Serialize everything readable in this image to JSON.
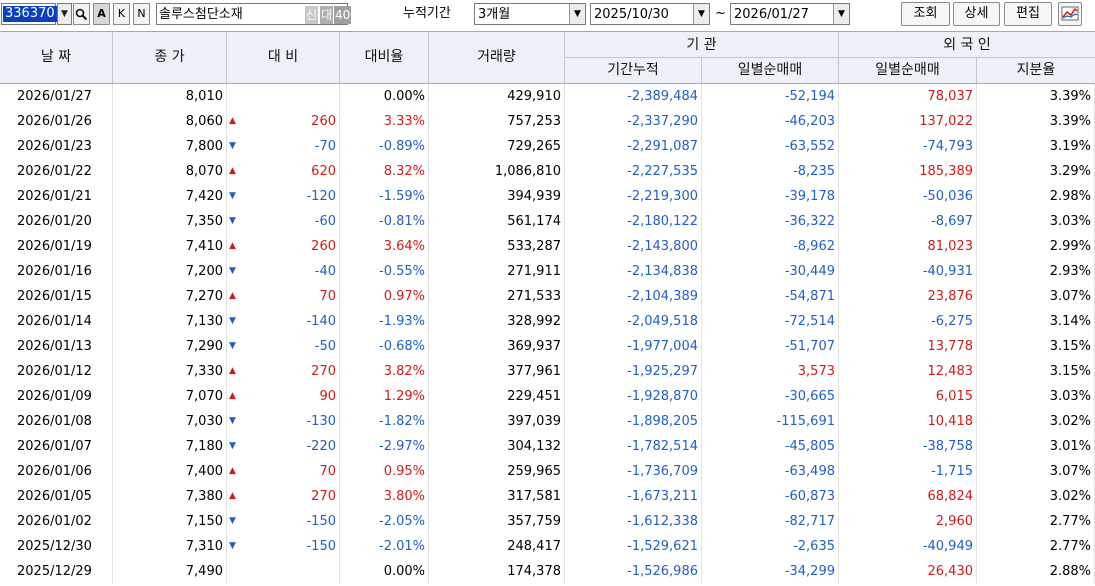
{
  "toolbar": {
    "code": "336370",
    "code_dropdown_icon": "chevron-down-icon",
    "search_icon": "search-icon",
    "button_a": "A",
    "button_k": "K",
    "button_n": "N",
    "stock_name": "솔루스첨단소재",
    "badge_sin": "신",
    "badge_dae": "대",
    "badge_40": "40",
    "period_label": "누적기간",
    "period_value": "3개월",
    "date_from": "2025/10/30",
    "tilde": "~",
    "date_to": "2026/01/27",
    "query_button": "조회",
    "detail_button": "상세",
    "edit_button": "편집",
    "chart_icon": "line-chart-icon"
  },
  "colors": {
    "up": "#d11a1a",
    "down": "#1f5fc7",
    "header_bg": "#eef0f8",
    "selection": "#0a3fbf"
  },
  "headers": {
    "date": "날 짜",
    "close": "종 가",
    "change": "대 비",
    "pct": "대비율",
    "volume": "거래량",
    "institution": "기 관",
    "inst_cum": "기간누적",
    "inst_daily": "일별순매매",
    "foreign": "외 국 인",
    "foreign_daily": "일별순매매",
    "share": "지분율"
  },
  "rows": [
    {
      "date": "2026/01/27",
      "close": "8,010",
      "dir": "none",
      "change": "",
      "pct": "0.00%",
      "volume": "429,910",
      "inst_cum": "-2,389,484",
      "inst_daily": "-52,194",
      "foreign_daily": "78,037",
      "share": "3.39%"
    },
    {
      "date": "2026/01/26",
      "close": "8,060",
      "dir": "up",
      "change": "260",
      "pct": "3.33%",
      "volume": "757,253",
      "inst_cum": "-2,337,290",
      "inst_daily": "-46,203",
      "foreign_daily": "137,022",
      "share": "3.39%"
    },
    {
      "date": "2026/01/23",
      "close": "7,800",
      "dir": "down",
      "change": "-70",
      "pct": "-0.89%",
      "volume": "729,265",
      "inst_cum": "-2,291,087",
      "inst_daily": "-63,552",
      "foreign_daily": "-74,793",
      "share": "3.19%"
    },
    {
      "date": "2026/01/22",
      "close": "8,070",
      "dir": "up",
      "change": "620",
      "pct": "8.32%",
      "volume": "1,086,810",
      "inst_cum": "-2,227,535",
      "inst_daily": "-8,235",
      "foreign_daily": "185,389",
      "share": "3.29%"
    },
    {
      "date": "2026/01/21",
      "close": "7,420",
      "dir": "down",
      "change": "-120",
      "pct": "-1.59%",
      "volume": "394,939",
      "inst_cum": "-2,219,300",
      "inst_daily": "-39,178",
      "foreign_daily": "-50,036",
      "share": "2.98%"
    },
    {
      "date": "2026/01/20",
      "close": "7,350",
      "dir": "down",
      "change": "-60",
      "pct": "-0.81%",
      "volume": "561,174",
      "inst_cum": "-2,180,122",
      "inst_daily": "-36,322",
      "foreign_daily": "-8,697",
      "share": "3.03%"
    },
    {
      "date": "2026/01/19",
      "close": "7,410",
      "dir": "up",
      "change": "260",
      "pct": "3.64%",
      "volume": "533,287",
      "inst_cum": "-2,143,800",
      "inst_daily": "-8,962",
      "foreign_daily": "81,023",
      "share": "2.99%"
    },
    {
      "date": "2026/01/16",
      "close": "7,200",
      "dir": "down",
      "change": "-40",
      "pct": "-0.55%",
      "volume": "271,911",
      "inst_cum": "-2,134,838",
      "inst_daily": "-30,449",
      "foreign_daily": "-40,931",
      "share": "2.93%"
    },
    {
      "date": "2026/01/15",
      "close": "7,270",
      "dir": "up",
      "change": "70",
      "pct": "0.97%",
      "volume": "271,533",
      "inst_cum": "-2,104,389",
      "inst_daily": "-54,871",
      "foreign_daily": "23,876",
      "share": "3.07%"
    },
    {
      "date": "2026/01/14",
      "close": "7,130",
      "dir": "down",
      "change": "-140",
      "pct": "-1.93%",
      "volume": "328,992",
      "inst_cum": "-2,049,518",
      "inst_daily": "-72,514",
      "foreign_daily": "-6,275",
      "share": "3.14%"
    },
    {
      "date": "2026/01/13",
      "close": "7,290",
      "dir": "down",
      "change": "-50",
      "pct": "-0.68%",
      "volume": "369,937",
      "inst_cum": "-1,977,004",
      "inst_daily": "-51,707",
      "foreign_daily": "13,778",
      "share": "3.15%"
    },
    {
      "date": "2026/01/12",
      "close": "7,330",
      "dir": "up",
      "change": "270",
      "pct": "3.82%",
      "volume": "377,961",
      "inst_cum": "-1,925,297",
      "inst_daily": "3,573",
      "foreign_daily": "12,483",
      "share": "3.15%"
    },
    {
      "date": "2026/01/09",
      "close": "7,070",
      "dir": "up",
      "change": "90",
      "pct": "1.29%",
      "volume": "229,451",
      "inst_cum": "-1,928,870",
      "inst_daily": "-30,665",
      "foreign_daily": "6,015",
      "share": "3.03%"
    },
    {
      "date": "2026/01/08",
      "close": "7,030",
      "dir": "down",
      "change": "-130",
      "pct": "-1.82%",
      "volume": "397,039",
      "inst_cum": "-1,898,205",
      "inst_daily": "-115,691",
      "foreign_daily": "10,418",
      "share": "3.02%"
    },
    {
      "date": "2026/01/07",
      "close": "7,180",
      "dir": "down",
      "change": "-220",
      "pct": "-2.97%",
      "volume": "304,132",
      "inst_cum": "-1,782,514",
      "inst_daily": "-45,805",
      "foreign_daily": "-38,758",
      "share": "3.01%"
    },
    {
      "date": "2026/01/06",
      "close": "7,400",
      "dir": "up",
      "change": "70",
      "pct": "0.95%",
      "volume": "259,965",
      "inst_cum": "-1,736,709",
      "inst_daily": "-63,498",
      "foreign_daily": "-1,715",
      "share": "3.07%"
    },
    {
      "date": "2026/01/05",
      "close": "7,380",
      "dir": "up",
      "change": "270",
      "pct": "3.80%",
      "volume": "317,581",
      "inst_cum": "-1,673,211",
      "inst_daily": "-60,873",
      "foreign_daily": "68,824",
      "share": "3.02%"
    },
    {
      "date": "2026/01/02",
      "close": "7,150",
      "dir": "down",
      "change": "-150",
      "pct": "-2.05%",
      "volume": "357,759",
      "inst_cum": "-1,612,338",
      "inst_daily": "-82,717",
      "foreign_daily": "2,960",
      "share": "2.77%"
    },
    {
      "date": "2025/12/30",
      "close": "7,310",
      "dir": "down",
      "change": "-150",
      "pct": "-2.01%",
      "volume": "248,417",
      "inst_cum": "-1,529,621",
      "inst_daily": "-2,635",
      "foreign_daily": "-40,949",
      "share": "2.77%"
    },
    {
      "date": "2025/12/29",
      "close": "7,490",
      "dir": "none",
      "change": "",
      "pct": "0.00%",
      "volume": "174,378",
      "inst_cum": "-1,526,986",
      "inst_daily": "-34,299",
      "foreign_daily": "26,430",
      "share": "2.88%"
    }
  ]
}
